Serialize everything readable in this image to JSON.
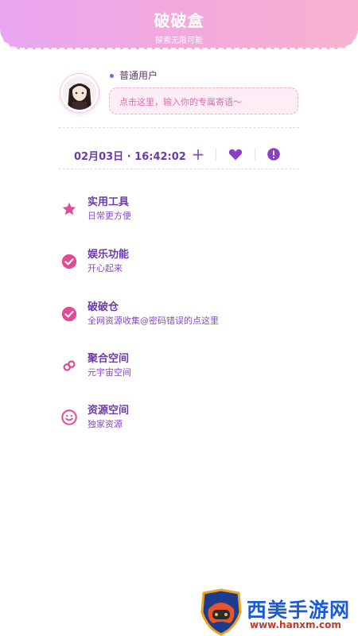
{
  "header": {
    "title": "破破盒",
    "subtitle": "探索无限可能"
  },
  "profile": {
    "user_type": "普通用户",
    "motto_placeholder": "点击这里，输入你的专属寄语〜"
  },
  "toolbar": {
    "time": "02月03日 · 16:42:02",
    "plus": "+"
  },
  "menu": [
    {
      "label": "实用工具",
      "desc": "日常更方便",
      "icon": "star-icon"
    },
    {
      "label": "娱乐功能",
      "desc": "开心起来",
      "icon": "check-circle-icon"
    },
    {
      "label": "破破仓",
      "desc": "全网资源收集@密码错误的点这里",
      "icon": "check-circle-icon"
    },
    {
      "label": "聚合空间",
      "desc": "元宇宙空间",
      "icon": "link-icon"
    },
    {
      "label": "资源空间",
      "desc": "独家资源",
      "icon": "smile-icon"
    }
  ],
  "watermark": {
    "name": "西美手游网",
    "url": "www.hanxm.com"
  },
  "colors": {
    "accent": "#e34a8f",
    "purple": "#6b3aa7",
    "header_start": "#e9a6f2",
    "header_end": "#f7b2cf"
  }
}
